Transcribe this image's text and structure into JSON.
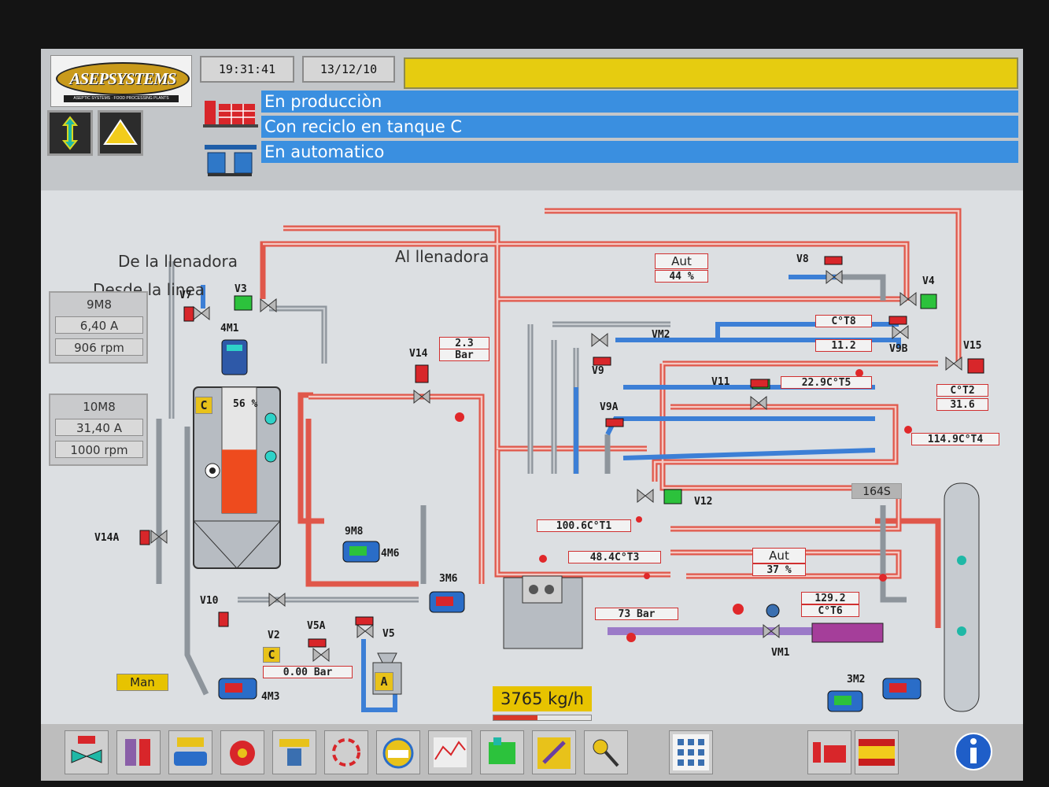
{
  "header": {
    "logo": "ASEPSYSTEMS",
    "logo_tagline": "ASEPTIC SYSTEMS · FOOD PROCESSING PLANTS",
    "time": "19:31:41",
    "date": "13/12/10",
    "status_lines": [
      "En producciòn",
      "Con reciclo en tanque C",
      "En automatico"
    ]
  },
  "diagram": {
    "labels": {
      "de_llenadora": "De la llenadora",
      "al_llenadora": "Al llenadora",
      "desde_linea": "Desde la linea"
    },
    "motor_9m8": {
      "name": "9M8",
      "current": "6,40 A",
      "speed": "906 rpm"
    },
    "motor_10m8": {
      "name": "10M8",
      "current": "31,40 A",
      "speed": "1000 rpm"
    },
    "tank_c": {
      "tag": "C",
      "level": "56 %",
      "level_fraction": 0.56
    },
    "tank_a": {
      "tag": "A"
    },
    "valves": [
      "V7",
      "V3",
      "V14",
      "V8",
      "V4",
      "V9",
      "V9B",
      "V15",
      "V11",
      "V9A",
      "V12",
      "V14A",
      "V10",
      "V2",
      "V5A",
      "V5",
      "VM1",
      "VM2"
    ],
    "equipment": [
      "4M1",
      "9M8",
      "4M6",
      "3M6",
      "4M3",
      "3M2"
    ],
    "readings": {
      "pressure_v14": "2.3",
      "pressure_v14_unit": "Bar",
      "valve_aut_1_mode": "Aut",
      "valve_aut_1_pct": "44 %",
      "t8": "C°T8",
      "t8_value": "11.2",
      "t5": "22.9C°T5",
      "t2_label": "C°T2",
      "t2_value": "31.6",
      "t4": "114.9C°T4",
      "holding_time": "164S",
      "t1": "100.6C°T1",
      "t3": "48.4C°T3",
      "valve_aut_2_mode": "Aut",
      "valve_aut_2_pct": "37 %",
      "pressure_homog": "73 Bar",
      "t6_value": "129.2",
      "t6_label": "C°T6",
      "pressure_c": "0.00 Bar",
      "c_tag": "C"
    },
    "mode": "Man",
    "flow": "3765 kg/h",
    "flow_fraction": 0.45
  },
  "toolbar": {
    "icons": [
      "valve-icon",
      "motor-icon",
      "pump-icon",
      "alarm-icon",
      "lamp-icon",
      "cycle-icon",
      "counter-icon",
      "trend-chart-icon",
      "recipe-icon",
      "tools-icon",
      "key-icon",
      "keypad-icon",
      "plant-icon",
      "language-flag-icon",
      "info-icon"
    ]
  },
  "colors": {
    "status_blue": "#3a8fe0",
    "alarm_yellow": "#e6cc10",
    "hot_pipe": "#e0574a",
    "cold_pipe": "#3c7fd6",
    "valve_red": "#d8262a",
    "valve_green": "#2cc23c"
  }
}
